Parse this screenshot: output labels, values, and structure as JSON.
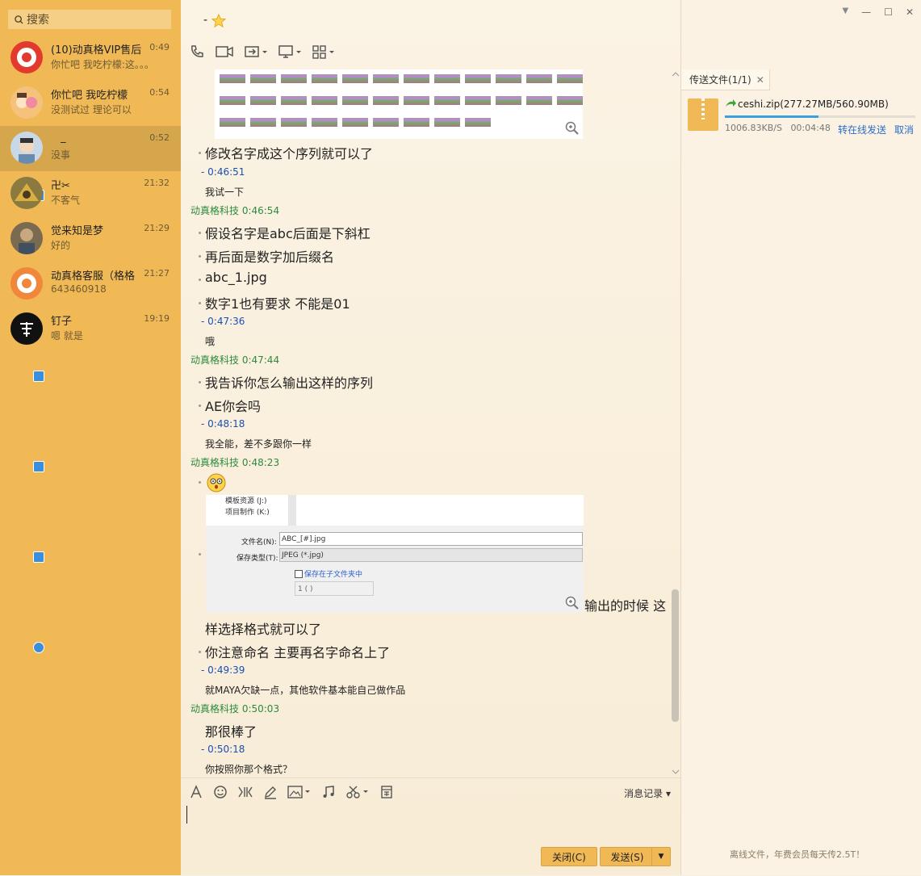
{
  "search": {
    "placeholder": "搜索"
  },
  "contacts": [
    {
      "name": "(10)动真格VIP售后",
      "msg": "你忙吧 我吃柠檬:这。。。",
      "time": "0:49"
    },
    {
      "name": "你忙吧 我吃柠檬",
      "msg": "没测试过 理论可以",
      "time": "0:54"
    },
    {
      "name": "_",
      "msg": "没事",
      "time": "0:52"
    },
    {
      "name": "卍✂",
      "msg": "不客气",
      "time": "21:32"
    },
    {
      "name": "觉来知是梦",
      "msg": "好的",
      "time": "21:29"
    },
    {
      "name": "动真格客服（格格",
      "msg": "643460918",
      "time": "21:27"
    },
    {
      "name": "钉子",
      "msg": "嗯 就是",
      "time": "19:19"
    }
  ],
  "chat": {
    "title": "-",
    "messages": {
      "m1": "修改名字成这个序列就可以了",
      "me1": "-   0:46:51",
      "s1": "我试一下",
      "ot1": "动真格科技   0:46:54",
      "m2": "假设名字是abc后面是下斜杠",
      "m3": "再后面是数字加后缀名",
      "m4": "abc_1.jpg",
      "m5": "数字1也有要求  不能是01",
      "me2": "-   0:47:36",
      "s2": "哦",
      "ot2": "动真格科技   0:47:44",
      "m6": "我告诉你怎么输出这样的序列",
      "m7": "AE你会吗",
      "me3": "-   0:48:18",
      "s3": "我全能，差不多跟你一样",
      "ot3": "动真格科技   0:48:23",
      "m8a": "输出的时候 这",
      "m8b": "样选择格式就可以了",
      "m9": "你注意命名 主要再名字命名上了",
      "me4": "-   0:49:39",
      "s4": "就MAYA欠缺一点，其他软件基本能自己做作品",
      "ot4": "动真格科技   0:50:03",
      "m10": "那很棒了",
      "me5": "-   0:50:18",
      "s5": "你按照你那个格式？"
    },
    "dialog": {
      "drive1": "模板资源 (J:)",
      "drive2": "项目制作 (K:)",
      "fname_label": "文件名(N):",
      "fname_value": "ABC_[#].jpg",
      "ftype_label": "保存类型(T):",
      "ftype_value": "JPEG (*.jpg)",
      "subfolder": "保存在子文件夹中",
      "field": "1 ( )"
    }
  },
  "input": {
    "history": "消息记录",
    "close_btn": "关闭(C)",
    "send_btn": "发送(S)"
  },
  "transfer": {
    "tab": "传送文件(1/1)",
    "file": "ceshi.zip(277.27MB/560.90MB)",
    "progress": 0.49,
    "speed": "1006.83KB/S",
    "remain": "00:04:48",
    "online": "转在线发送",
    "cancel": "取消",
    "footer": "离线文件，年费会员每天传2.5T！"
  },
  "colors": {
    "sidebar": "#f0b955",
    "accent": "#3aa0e0"
  }
}
